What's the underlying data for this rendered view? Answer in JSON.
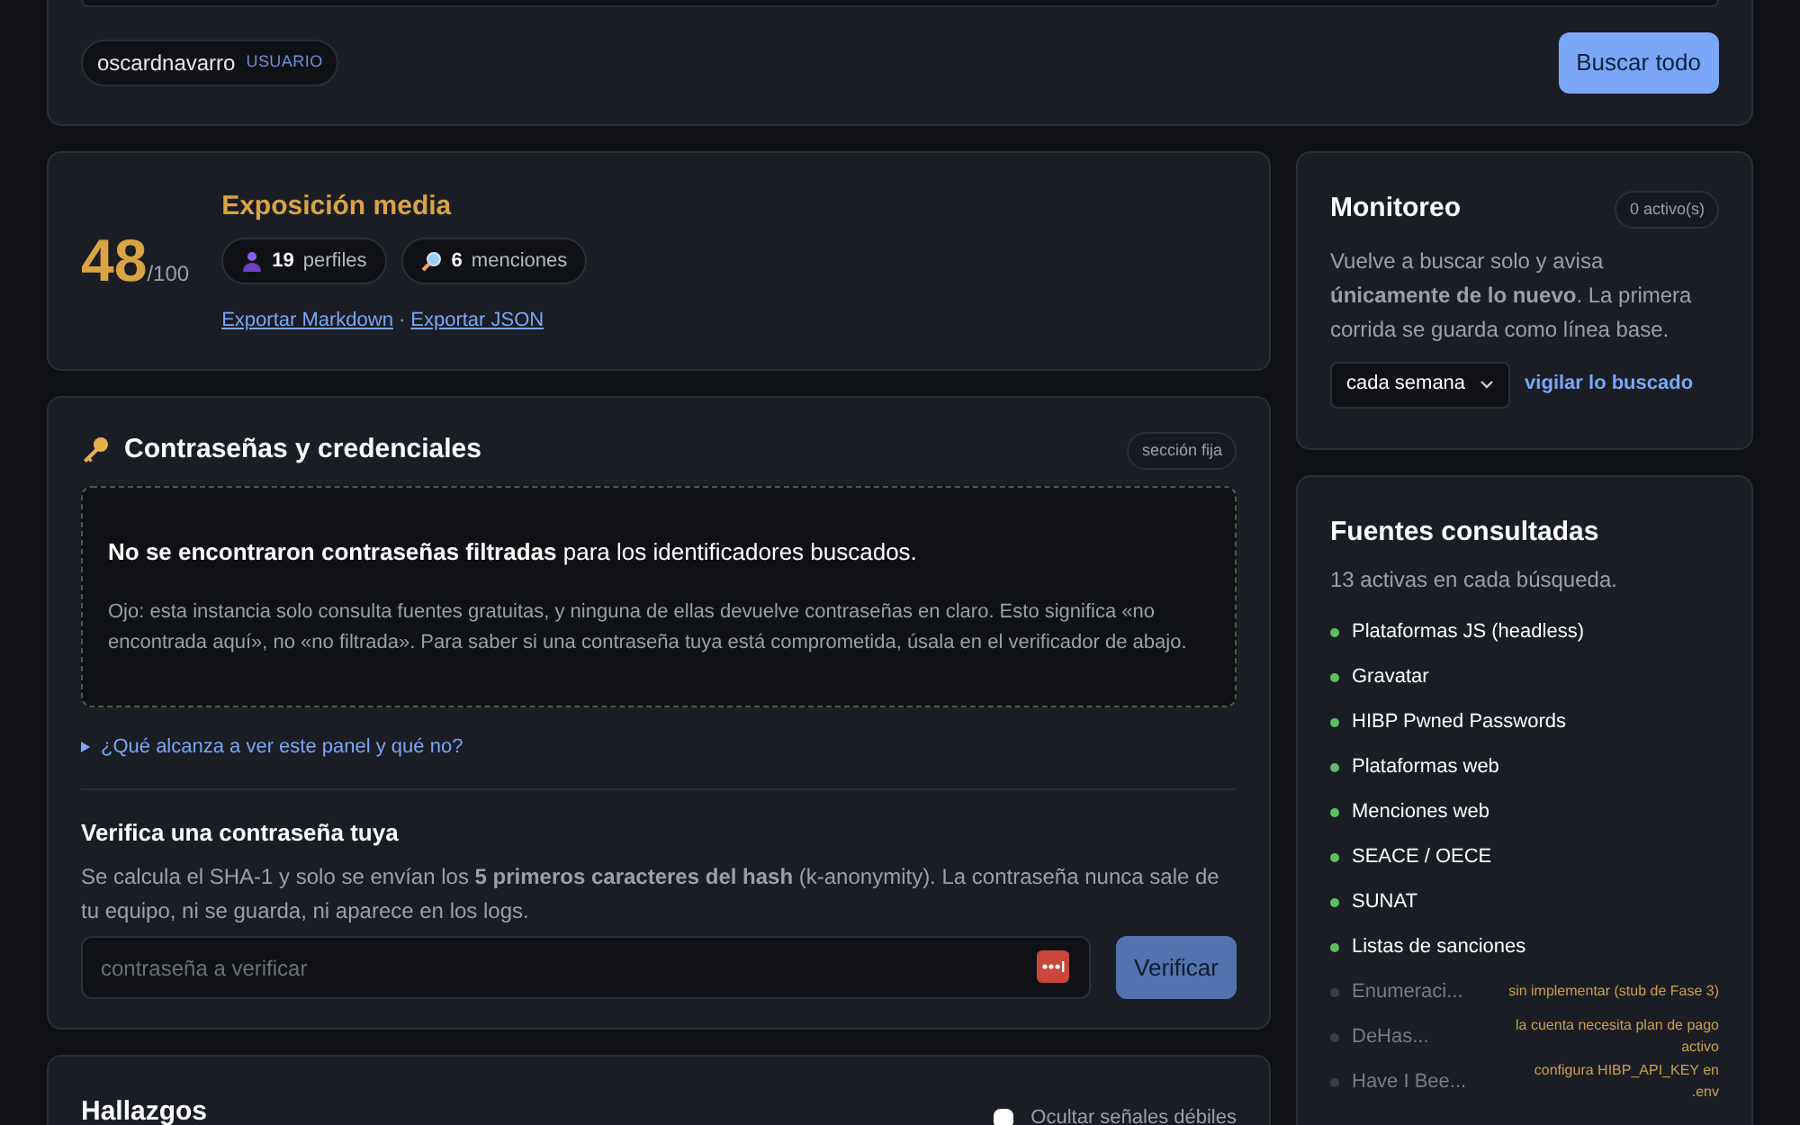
{
  "search": {
    "user_chip": {
      "value": "oscardnavarro",
      "tag": "USUARIO"
    },
    "button": "Buscar todo"
  },
  "exposure": {
    "score": "48",
    "max": "/100",
    "title": "Exposición media",
    "stats": [
      {
        "kind": "profiles",
        "count": "19",
        "label": "perfiles"
      },
      {
        "kind": "mentions",
        "count": "6",
        "label": "menciones"
      }
    ],
    "links": [
      "Exportar Markdown",
      "Exportar JSON"
    ],
    "separator": "·"
  },
  "passwords": {
    "title": "Contraseñas y credenciales",
    "badge": "sección fija",
    "result": "**No se encontraron contraseñas filtradas** para los identificadores buscados.",
    "note": "Ojo: esta instancia solo consulta fuentes gratuitas, y ninguna de ellas devuelve contraseñas en claro. Esto significa «no encontrada aquí», no «no filtrada». Para saber si una contraseña tuya está comprometida, úsala en el verificador de abajo.",
    "disclosure": {
      "label": "¿Qué alcanza a ver este panel y qué no?",
      "expanded": false
    },
    "verify_title": "Verifica una contraseña tuya",
    "verify_text": "Se calcula el SHA-1 y solo se envían los **5 primeros caracteres del hash** (k-anonymity). La contraseña nunca sale de tu equipo, ni se guarda, ni aparece en los logs.",
    "input": {
      "placeholder": "contraseña a verificar"
    },
    "button": "Verificar"
  },
  "findings": {
    "title": "Hallazgos",
    "hide_weak": {
      "label": "Ocultar señales débiles",
      "checked": false
    }
  },
  "monitor": {
    "title": "Monitoreo",
    "badge": "0 activo(s)",
    "text": "Vuelve a buscar solo y avisa **únicamente de lo nuevo**. La primera corrida se guarda como línea base.",
    "frequency": "cada semana",
    "link": "vigilar lo buscado"
  },
  "sources": {
    "title": "Fuentes consultadas",
    "subtitle": "13 activas en cada búsqueda.",
    "items": [
      {
        "name": "Plataformas JS (headless)",
        "active": true
      },
      {
        "name": "Gravatar",
        "active": true
      },
      {
        "name": "HIBP Pwned Passwords",
        "active": true
      },
      {
        "name": "Plataformas web",
        "active": true
      },
      {
        "name": "Menciones web",
        "active": true
      },
      {
        "name": "SEACE / OECE",
        "active": true
      },
      {
        "name": "SUNAT",
        "active": true
      },
      {
        "name": "Listas de sanciones",
        "active": true
      },
      {
        "name": "Enumeraci...",
        "active": false,
        "note": "sin implementar (stub de Fase 3)"
      },
      {
        "name": "DeHas...",
        "active": false,
        "note": "la cuenta necesita plan de pago activo"
      },
      {
        "name": "Have I Bee...",
        "active": false,
        "note": "configura HIBP_API_KEY en .env"
      }
    ]
  }
}
